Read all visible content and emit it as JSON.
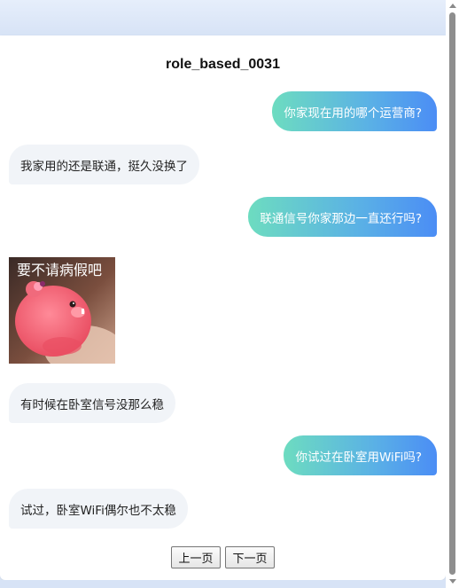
{
  "title": "role_based_0031",
  "messages": [
    {
      "side": "right",
      "text": "你家现在用的哪个运营商?"
    },
    {
      "side": "left",
      "text": "我家用的还是联通，挺久没换了"
    },
    {
      "side": "right",
      "text": "联通信号你家那边一直还行吗?"
    },
    {
      "side": "left",
      "type": "sticker",
      "text": "要不请病假吧"
    },
    {
      "side": "left",
      "text": "有时候在卧室信号没那么稳"
    },
    {
      "side": "right",
      "text": "你试过在卧室用WiFi吗?"
    },
    {
      "side": "left",
      "text": "试过，卧室WiFi偶尔也不太稳"
    }
  ],
  "pagination": {
    "prev_label": "上一页",
    "next_label": "下一页"
  },
  "colors": {
    "bubble_gradient_start": "#6ddcc0",
    "bubble_gradient_end": "#4b8df5",
    "left_bubble_bg": "#f1f4f8",
    "page_bg": "#dde7f6"
  }
}
